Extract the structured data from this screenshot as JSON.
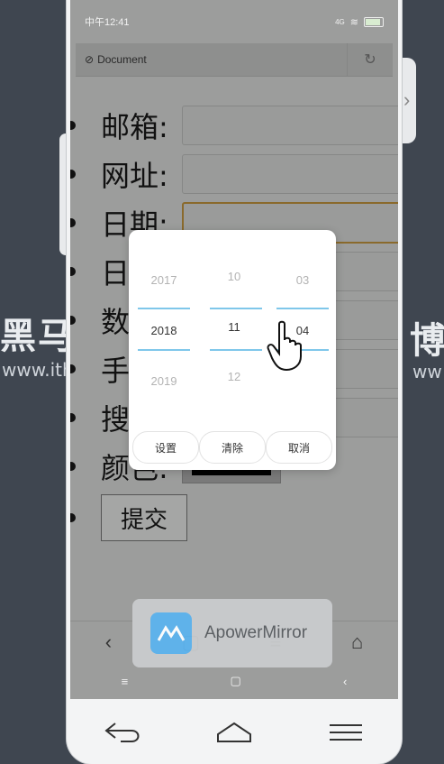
{
  "background": {
    "logo_left": "黑马",
    "url_left": "www.ith",
    "logo_right": "博",
    "url_right": "ww"
  },
  "status": {
    "time": "中午12:41",
    "signal_text": "4G"
  },
  "browser": {
    "title": "Document",
    "reload_icon": "reload-icon"
  },
  "form": {
    "labels": [
      "邮箱:",
      "网址:",
      "日期:",
      "日",
      "数",
      "手",
      "搜",
      "颜色:"
    ],
    "submit": "提交"
  },
  "picker": {
    "years": [
      "2017",
      "2018",
      "2019"
    ],
    "months": [
      "10",
      "11",
      "12"
    ],
    "days": [
      "03",
      "04"
    ],
    "selected": {
      "year": "2018",
      "month": "11",
      "day": "04"
    },
    "buttons": {
      "set": "设置",
      "clear": "清除",
      "cancel": "取消"
    },
    "accent": "#7fc7ea"
  },
  "toast": {
    "app_name": "ApowerMirror"
  },
  "colors": {
    "background": "#3f4650",
    "screen": "#9c9d9c",
    "picker_accent": "#7fc7ea"
  }
}
